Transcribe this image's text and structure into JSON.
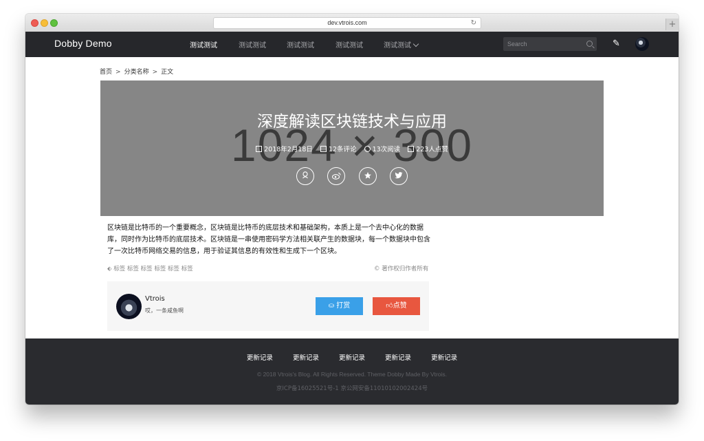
{
  "browser": {
    "url": "dev.vtrois.com",
    "reload_glyph": "↻",
    "newtab_glyph": "+"
  },
  "nav": {
    "brand": "Dobby Demo",
    "items": [
      "测试测试",
      "测试测试",
      "测试测试",
      "测试测试",
      "测试测试"
    ],
    "active_index": 0,
    "search_placeholder": "Search",
    "edit_icon": "pencil-icon",
    "avatar_icon": "avatar"
  },
  "breadcrumb": {
    "home": "首页",
    "category": "分类名称",
    "current": "正文",
    "separator": ">"
  },
  "hero": {
    "placeholder_text": "1024 × 300",
    "title": "深度解读区块链技术与应用",
    "date": "2018年2月18日",
    "comments": "12条评论",
    "views": "13次阅读",
    "likes": "223人点赞",
    "share_icons": [
      "qq-icon",
      "weibo-icon",
      "star-icon",
      "twitter-icon"
    ]
  },
  "article": {
    "paragraph": "区块链是比特币的一个重要概念，区块链是比特币的底层技术和基础架构，本质上是一个去中心化的数据库，同时作为比特币的底层技术。区块链是一串使用密码学方法相关联产生的数据块，每一个数据块中包含了一次比特币网络交易的信息，用于验证其信息的有效性和生成下一个区块。",
    "tags": "标签 标签 标签 标签 标签 标签",
    "copyright": "© 著作权归作者所有"
  },
  "author": {
    "name": "Vtrois",
    "bio": "哎，一条咸鱼啊",
    "reward_label": "打赏",
    "like_label": "点赞"
  },
  "footer": {
    "links": [
      "更新记录",
      "更新记录",
      "更新记录",
      "更新记录",
      "更新记录"
    ],
    "copyright": "© 2018 Vtrois's Blog. All Rights Reserved. Theme Dobby Made By Vtrois.",
    "icp": "京ICP备16025521号-1 京公网安备11010102002424号"
  },
  "colors": {
    "nav_bg": "#26272b",
    "footer_bg": "#2a2b2f",
    "hero_bg": "#868686",
    "reward_btn": "#3aa0e8",
    "like_btn": "#e8573f"
  }
}
